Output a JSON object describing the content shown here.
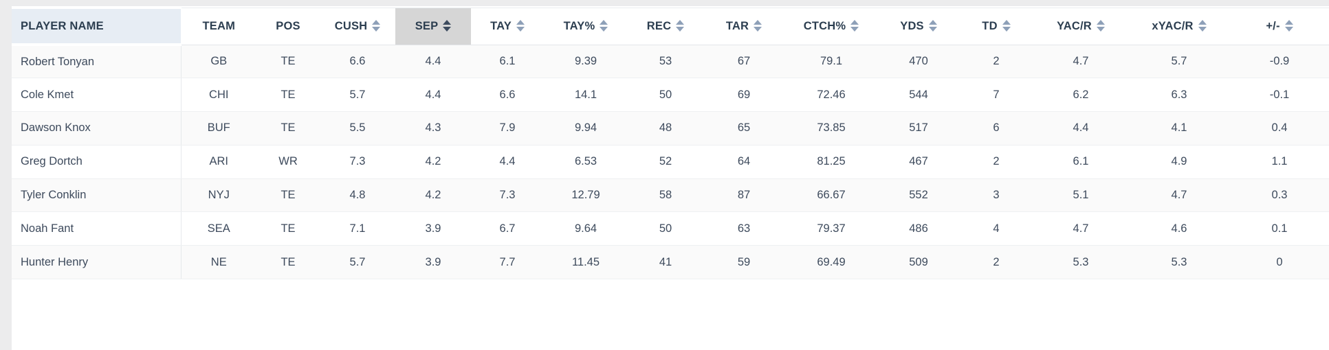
{
  "table": {
    "sorted_column": "SEP",
    "sort_icon_name": "sort-updown-icon",
    "columns": [
      {
        "key": "player",
        "label": "PLAYER NAME",
        "sortable": false,
        "align": "left"
      },
      {
        "key": "team",
        "label": "TEAM",
        "sortable": false,
        "align": "center"
      },
      {
        "key": "pos",
        "label": "POS",
        "sortable": false,
        "align": "center"
      },
      {
        "key": "cush",
        "label": "CUSH",
        "sortable": true,
        "align": "center"
      },
      {
        "key": "sep",
        "label": "SEP",
        "sortable": true,
        "align": "center"
      },
      {
        "key": "tay",
        "label": "TAY",
        "sortable": true,
        "align": "center"
      },
      {
        "key": "taypct",
        "label": "TAY%",
        "sortable": true,
        "align": "center"
      },
      {
        "key": "rec",
        "label": "REC",
        "sortable": true,
        "align": "center"
      },
      {
        "key": "tar",
        "label": "TAR",
        "sortable": true,
        "align": "center"
      },
      {
        "key": "ctch",
        "label": "CTCH%",
        "sortable": true,
        "align": "center"
      },
      {
        "key": "yds",
        "label": "YDS",
        "sortable": true,
        "align": "center"
      },
      {
        "key": "td",
        "label": "TD",
        "sortable": true,
        "align": "center"
      },
      {
        "key": "yacr",
        "label": "YAC/R",
        "sortable": true,
        "align": "center"
      },
      {
        "key": "xyacr",
        "label": "xYAC/R",
        "sortable": true,
        "align": "center"
      },
      {
        "key": "pm",
        "label": "+/-",
        "sortable": true,
        "align": "center"
      }
    ],
    "rows": [
      {
        "player": "Robert Tonyan",
        "team": "GB",
        "pos": "TE",
        "cush": "6.6",
        "sep": "4.4",
        "tay": "6.1",
        "taypct": "9.39",
        "rec": "53",
        "tar": "67",
        "ctch": "79.1",
        "yds": "470",
        "td": "2",
        "yacr": "4.7",
        "xyacr": "5.7",
        "pm": "-0.9"
      },
      {
        "player": "Cole Kmet",
        "team": "CHI",
        "pos": "TE",
        "cush": "5.7",
        "sep": "4.4",
        "tay": "6.6",
        "taypct": "14.1",
        "rec": "50",
        "tar": "69",
        "ctch": "72.46",
        "yds": "544",
        "td": "7",
        "yacr": "6.2",
        "xyacr": "6.3",
        "pm": "-0.1"
      },
      {
        "player": "Dawson Knox",
        "team": "BUF",
        "pos": "TE",
        "cush": "5.5",
        "sep": "4.3",
        "tay": "7.9",
        "taypct": "9.94",
        "rec": "48",
        "tar": "65",
        "ctch": "73.85",
        "yds": "517",
        "td": "6",
        "yacr": "4.4",
        "xyacr": "4.1",
        "pm": "0.4"
      },
      {
        "player": "Greg Dortch",
        "team": "ARI",
        "pos": "WR",
        "cush": "7.3",
        "sep": "4.2",
        "tay": "4.4",
        "taypct": "6.53",
        "rec": "52",
        "tar": "64",
        "ctch": "81.25",
        "yds": "467",
        "td": "2",
        "yacr": "6.1",
        "xyacr": "4.9",
        "pm": "1.1"
      },
      {
        "player": "Tyler Conklin",
        "team": "NYJ",
        "pos": "TE",
        "cush": "4.8",
        "sep": "4.2",
        "tay": "7.3",
        "taypct": "12.79",
        "rec": "58",
        "tar": "87",
        "ctch": "66.67",
        "yds": "552",
        "td": "3",
        "yacr": "5.1",
        "xyacr": "4.7",
        "pm": "0.3"
      },
      {
        "player": "Noah Fant",
        "team": "SEA",
        "pos": "TE",
        "cush": "7.1",
        "sep": "3.9",
        "tay": "6.7",
        "taypct": "9.64",
        "rec": "50",
        "tar": "63",
        "ctch": "79.37",
        "yds": "486",
        "td": "4",
        "yacr": "4.7",
        "xyacr": "4.6",
        "pm": "0.1"
      },
      {
        "player": "Hunter Henry",
        "team": "NE",
        "pos": "TE",
        "cush": "5.7",
        "sep": "3.9",
        "tay": "7.7",
        "taypct": "11.45",
        "rec": "41",
        "tar": "59",
        "ctch": "69.49",
        "yds": "509",
        "td": "2",
        "yacr": "5.3",
        "xyacr": "5.3",
        "pm": "0"
      }
    ]
  },
  "colors": {
    "page_background": "#ececed",
    "card_background": "#ffffff",
    "player_header_background": "#e7edf4",
    "sorted_header_background": "#d6d6d6",
    "row_odd_background": "#fafafa",
    "row_even_background": "#ffffff",
    "header_text": "#2c3e50",
    "body_text": "#3d4a5c",
    "sort_arrow": "#8ea0b8",
    "sort_arrow_active": "#3c4b5e",
    "row_border": "#eef0f2"
  }
}
